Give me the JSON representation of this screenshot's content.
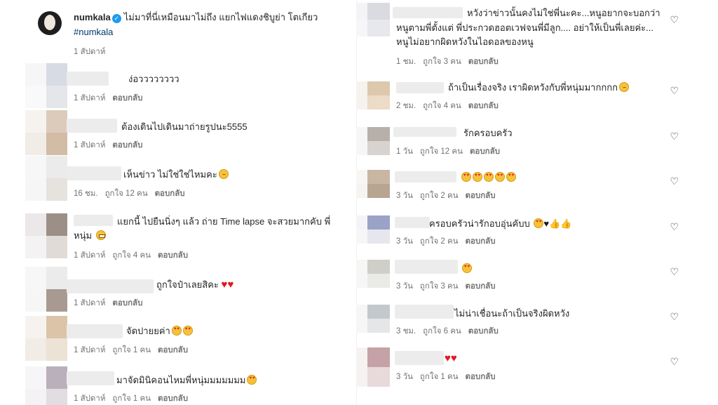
{
  "post": {
    "username": "numkala",
    "caption": "ไม่มาที่นี่เหมือนมาไม่ถึง แยกไฟแดงชิบูย่า โตเกียว",
    "hashtag": "#numkala",
    "time": "1 สัปดาห์"
  },
  "labels": {
    "reply": "ตอบกลับ"
  },
  "left_comments": [
    {
      "text": "ง่อวววววววว",
      "time": "1 สัปดาห์",
      "likes": ""
    },
    {
      "text": "ต้องเดินไปเดินมาถ่ายรูปนะ5555",
      "time": "1 สัปดาห์",
      "likes": ""
    },
    {
      "text": "เห็นข่าว ไม่ใช่ใช่ไหมคะ",
      "time": "16 ชม.",
      "likes": "ถูกใจ 12 คน"
    },
    {
      "text": "แยกนี้ ไปยืนนิ่งๆ แล้ว ถ่าย Time lapse จะสวยมากคับ พี่",
      "text2": "หนุ่ม",
      "time": "1 สัปดาห์",
      "likes": "ถูกใจ 4 คน"
    },
    {
      "text": "ถูกใจป๋าเลยสิคะ",
      "time": "1 สัปดาห์",
      "likes": ""
    },
    {
      "text": "จัดปายยค่า",
      "time": "1 สัปดาห์",
      "likes": "ถูกใจ 1 คน"
    },
    {
      "text": "มาจัดมินิคอนไหมพี่หนุ่มมมมมมม",
      "time": "1 สัปดาห์",
      "likes": "ถูกใจ 1 คน"
    }
  ],
  "right_comments": [
    {
      "text": "หวังว่าข่าวนั้นคงไม่ใช่พี่นะคะ...หนูอยากจะบอกว่า",
      "text2": "หนูตามพี่ตั้งแต่ พี่ประกวดฮอตเวฟจนพี่มีลูก.... อย่าให้เป็นพี่เลยค่ะ...",
      "text3": "หนูไม่อยากผิดหวังในไอดอลของหนู",
      "time": "1 ชม.",
      "likes": "ถูกใจ 3 คน"
    },
    {
      "text": "ถ้าเป็นเรื่องจริง เราผิดหวังกับพี่หนุ่มมากกกก",
      "time": "2 ชม.",
      "likes": "ถูกใจ 4 คน"
    },
    {
      "text": "รักครอบครัว",
      "time": "1 วัน",
      "likes": "ถูกใจ 12 คน"
    },
    {
      "text": "",
      "time": "3 วัน",
      "likes": "ถูกใจ 2 คน"
    },
    {
      "text": "ครอบครัวน่ารักอบอุ่นคับบ",
      "time": "3 วัน",
      "likes": "ถูกใจ 2 คน"
    },
    {
      "text": "",
      "time": "3 วัน",
      "likes": "ถูกใจ 3 คน"
    },
    {
      "text": "ไม่น่าเชื่อนะถ้าเป็นจริงผิดหวัง",
      "time": "3 ชม.",
      "likes": "ถูกใจ 6 คน"
    },
    {
      "text": "",
      "time": "3 วัน",
      "likes": "ถูกใจ 1 คน"
    }
  ]
}
